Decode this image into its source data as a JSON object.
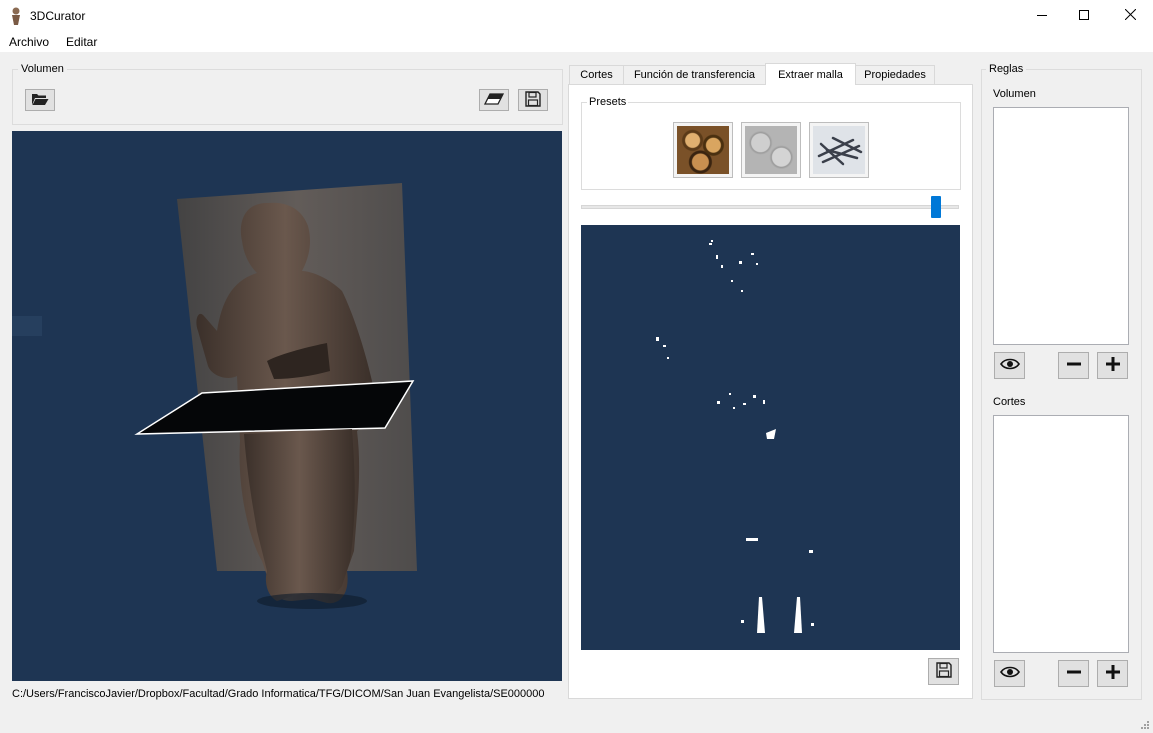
{
  "window": {
    "title": "3DCurator",
    "minimize_icon": "minimize-icon",
    "maximize_icon": "maximize-icon",
    "close_icon": "close-icon"
  },
  "menu": {
    "items": [
      "Archivo",
      "Editar"
    ]
  },
  "left": {
    "group_title": "Volumen",
    "toolbar": {
      "open_icon": "folder-open-icon",
      "erase_icon": "eraser-icon",
      "save_icon": "save-icon"
    },
    "status_path": "C:/Users/FranciscoJavier/Dropbox/Facultad/Grado Informatica/TFG/DICOM/San Juan Evangelista/SE000000",
    "background_color": "#1e3553"
  },
  "center": {
    "tabs": [
      "Cortes",
      "Función de transferencia",
      "Extraer malla",
      "Propiedades"
    ],
    "active_tab": "Extraer malla",
    "presets": {
      "title": "Presets",
      "items": [
        "wood-preset",
        "bone-preset",
        "metal-preset"
      ]
    },
    "slider": {
      "value": 0.95
    },
    "save_icon": "save-icon"
  },
  "right": {
    "group_title": "Reglas",
    "volumen_label": "Volumen",
    "cortes_label": "Cortes",
    "buttons": {
      "view_icon": "eye-icon",
      "remove_icon": "minus-icon",
      "add_icon": "plus-icon"
    }
  },
  "accent_color": "#0078d7"
}
